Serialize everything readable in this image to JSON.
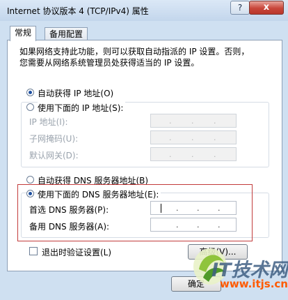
{
  "window": {
    "title": "Internet 协议版本 4 (TCP/IPv4) 属性",
    "help_label": "?",
    "close_label": "x"
  },
  "tabs": [
    {
      "label": "常规"
    },
    {
      "label": "备用配置"
    }
  ],
  "description": {
    "line1": "如果网络支持此功能，则可以获取自动指派的 IP 设置。否则，",
    "line2": "您需要从网络系统管理员处获得适当的 IP 设置。"
  },
  "ip": {
    "auto_label": "自动获得 IP 地址(O)",
    "auto_selected": true,
    "manual_label": "使用下面的 IP 地址(S):",
    "manual_selected": false,
    "fields": [
      {
        "label": "IP 地址(I):",
        "value": ". . ."
      },
      {
        "label": "子网掩码(U):",
        "value": ". . ."
      },
      {
        "label": "默认网关(D):",
        "value": ". . ."
      }
    ]
  },
  "dns": {
    "auto_label": "自动获得 DNS 服务器地址(B)",
    "auto_selected": false,
    "manual_label": "使用下面的 DNS 服务器地址(E):",
    "manual_selected": true,
    "fields": [
      {
        "label": "首选 DNS 服务器(P):",
        "value": ". . ."
      },
      {
        "label": "备用 DNS 服务器(A):",
        "value": ". . ."
      }
    ]
  },
  "validate_on_exit": {
    "label": "退出时验证设置(L)",
    "checked": false
  },
  "buttons": {
    "advanced": "高级(V)...",
    "ok": "确定"
  },
  "watermark": {
    "text": "IT技术网",
    "url": "www.itjs.cn"
  },
  "colors": {
    "accent": "#1d4fa0",
    "highlight": "#c23b3b",
    "close": "#c8463a"
  }
}
